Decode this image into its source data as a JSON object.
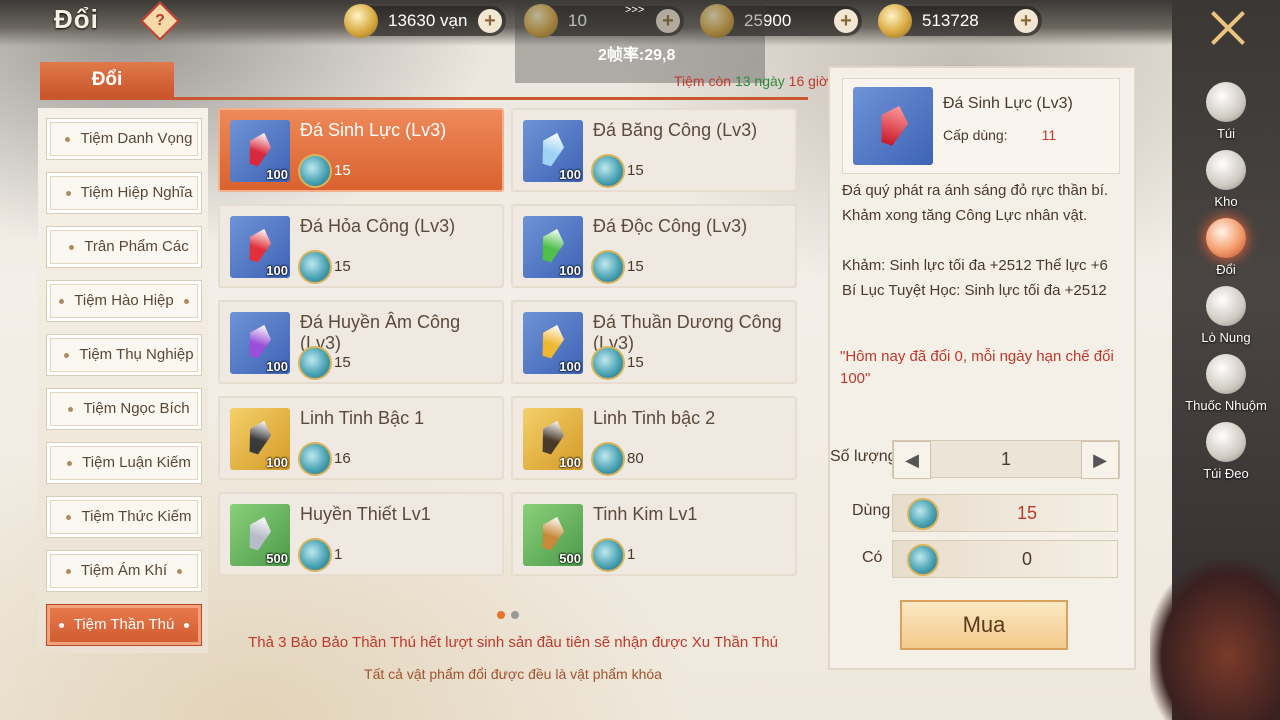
{
  "header": {
    "title": "Đổi",
    "help_glyph": "?",
    "resources": [
      {
        "icon": "copper-coin-icon",
        "value": "13630 vạn"
      },
      {
        "icon": "gold-coin-icon",
        "value": "10"
      },
      {
        "icon": "silver-ingot-icon",
        "value": "25900"
      },
      {
        "icon": "gold-ingot-icon",
        "value": "513728"
      }
    ],
    "plus_glyph": "+"
  },
  "debug_overlay": {
    "arrows": ">>>",
    "fps": "2帧率:29,8"
  },
  "tab": {
    "label": "Đổi"
  },
  "timer": {
    "prefix": "Tiệm còn ",
    "days": "13 ngày",
    "hours": " 16 giờ"
  },
  "sidebar": {
    "items": [
      {
        "label": "Tiệm Danh Vọng",
        "active": false
      },
      {
        "label": "Tiệm Hiệp Nghĩa",
        "active": false
      },
      {
        "label": "Trân Phẩm Các",
        "active": false
      },
      {
        "label": "Tiệm Hào Hiệp",
        "active": false
      },
      {
        "label": "Tiệm Thụ Nghiệp",
        "active": false
      },
      {
        "label": "Tiệm Ngọc Bích",
        "active": false
      },
      {
        "label": "Tiệm Luận Kiếm",
        "active": false
      },
      {
        "label": "Tiệm Thức Kiếm",
        "active": false
      },
      {
        "label": "Tiệm Ám Khí",
        "active": false
      },
      {
        "label": "Tiệm Thần Thú",
        "active": true
      }
    ]
  },
  "items": [
    {
      "name": "Đá Sinh Lực (Lv3)",
      "qty": "100",
      "price": "15",
      "icon": "red-gem-icon",
      "color": "#d8283c",
      "selected": true
    },
    {
      "name": "Đá Băng Công (Lv3)",
      "qty": "100",
      "price": "15",
      "icon": "blue-gem-icon",
      "color": "#9fd3f5",
      "selected": false
    },
    {
      "name": "Đá Hỏa Công (Lv3)",
      "qty": "100",
      "price": "15",
      "icon": "fire-gem-icon",
      "color": "#e0303a",
      "selected": false
    },
    {
      "name": "Đá Độc Công (Lv3)",
      "qty": "100",
      "price": "15",
      "icon": "green-gem-icon",
      "color": "#4fbf4a",
      "selected": false
    },
    {
      "name": "Đá Huyền Âm Công (Lv3)",
      "qty": "100",
      "price": "15",
      "icon": "purple-gem-icon",
      "color": "#9b4fd8",
      "selected": false
    },
    {
      "name": "Đá Thuần Dương Công (Lv3)",
      "qty": "100",
      "price": "15",
      "icon": "yellow-gem-icon",
      "color": "#f0b830",
      "selected": false
    },
    {
      "name": "Linh Tinh Bậc 1",
      "qty": "100",
      "price": "16",
      "icon": "dark-crystal-icon",
      "color": "#3a3a3a",
      "selected": false
    },
    {
      "name": "Linh Tinh bậc 2",
      "qty": "100",
      "price": "80",
      "icon": "dark-crystal-icon",
      "color": "#4a3a2a",
      "selected": false
    },
    {
      "name": "Huyền Thiết Lv1",
      "qty": "500",
      "price": "1",
      "icon": "silver-ore-icon",
      "color": "#b8bcc8",
      "selected": false
    },
    {
      "name": "Tinh Kim Lv1",
      "qty": "500",
      "price": "1",
      "icon": "gold-ore-icon",
      "color": "#c88a3a",
      "selected": false
    }
  ],
  "footer": {
    "note1": "Thả 3 Bảo Bảo Thần Thú hết lượt sinh sản đầu tiên sẽ nhận được Xu Thần Thú",
    "note2": "Tất cả vật phẩm đổi được đều là vật phẩm khóa"
  },
  "detail": {
    "name": "Đá Sinh Lực (Lv3)",
    "level_label": "Cấp dùng:",
    "level_value": "11",
    "desc1": "Đá quý phát ra ánh sáng đỏ rực thần bí.",
    "desc2": "Khảm xong tăng Công Lực nhân vật.",
    "stat1": "Khảm: Sinh lực tối đa +2512  Thể lực +6",
    "stat2": "Bí Lục Tuyệt Học: Sinh lực tối đa +2512",
    "limit": "\"Hôm nay đã đổi 0, mỗi ngày hạn chế đổi 100\"",
    "qty_label": "Số lượng",
    "qty_value": "1",
    "cost_label": "Dùng",
    "cost_value": "15",
    "have_label": "Có",
    "have_value": "0",
    "buy_label": "Mua",
    "cost_color": "#c0392b"
  },
  "nav": [
    {
      "label": "Túi",
      "icon": "bag-icon",
      "active": false
    },
    {
      "label": "Kho",
      "icon": "warehouse-icon",
      "active": false
    },
    {
      "label": "Đổi",
      "icon": "exchange-icon",
      "active": true
    },
    {
      "label": "Lò Nung",
      "icon": "furnace-icon",
      "active": false
    },
    {
      "label": "Thuốc Nhuộm",
      "icon": "dye-icon",
      "active": false
    },
    {
      "label": "Túi Đeo",
      "icon": "pouch-icon",
      "active": false
    }
  ]
}
